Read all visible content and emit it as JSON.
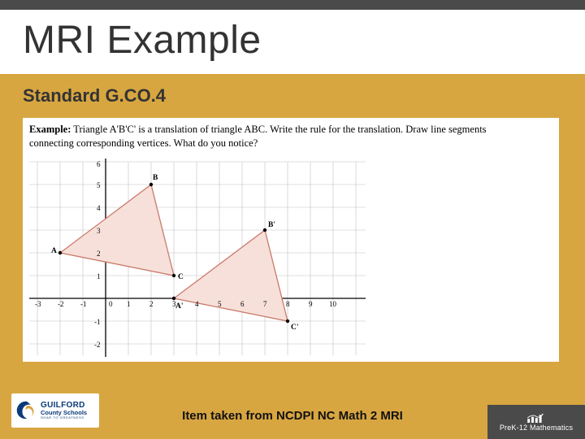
{
  "slide": {
    "title": "MRI Example",
    "subtitle": "Standard G.CO.4",
    "example_prefix": "Example:",
    "example_body_1": "Triangle A'B'C' is a translation of triangle ABC.  Write the rule for the translation.  Draw line segments",
    "example_body_2": "connecting corresponding vertices.  What do you notice?",
    "caption": "Item taken from NCDPI NC Math 2 MRI"
  },
  "logo": {
    "top": "GUILFORD",
    "bottom": "County Schools",
    "tag": "SOAR TO GREATNESS"
  },
  "department": {
    "label": "PreK-12 Mathematics"
  },
  "chart_data": {
    "type": "scatter",
    "title": "",
    "xlabel": "",
    "ylabel": "",
    "xlim": [
      -3,
      11
    ],
    "ylim": [
      -3,
      6
    ],
    "grid": true,
    "x_ticks": [
      "-3",
      "-2",
      "-1",
      "0",
      "1",
      "2",
      "3",
      "4",
      "5",
      "6",
      "7",
      "8",
      "9",
      "10"
    ],
    "y_ticks": [
      "-2",
      "-1",
      "0",
      "1",
      "2",
      "3",
      "4",
      "5",
      "6"
    ],
    "series": [
      {
        "name": "ABC",
        "points": [
          {
            "label": "A",
            "x": -2,
            "y": 2
          },
          {
            "label": "B",
            "x": 2,
            "y": 5
          },
          {
            "label": "C",
            "x": 3,
            "y": 1
          }
        ],
        "fill": "#f7e0da"
      },
      {
        "name": "A'B'C'",
        "points": [
          {
            "label": "A'",
            "x": 3,
            "y": 0
          },
          {
            "label": "B'",
            "x": 7,
            "y": 3
          },
          {
            "label": "C'",
            "x": 8,
            "y": -1
          }
        ],
        "fill": "#f7e0da"
      }
    ]
  }
}
